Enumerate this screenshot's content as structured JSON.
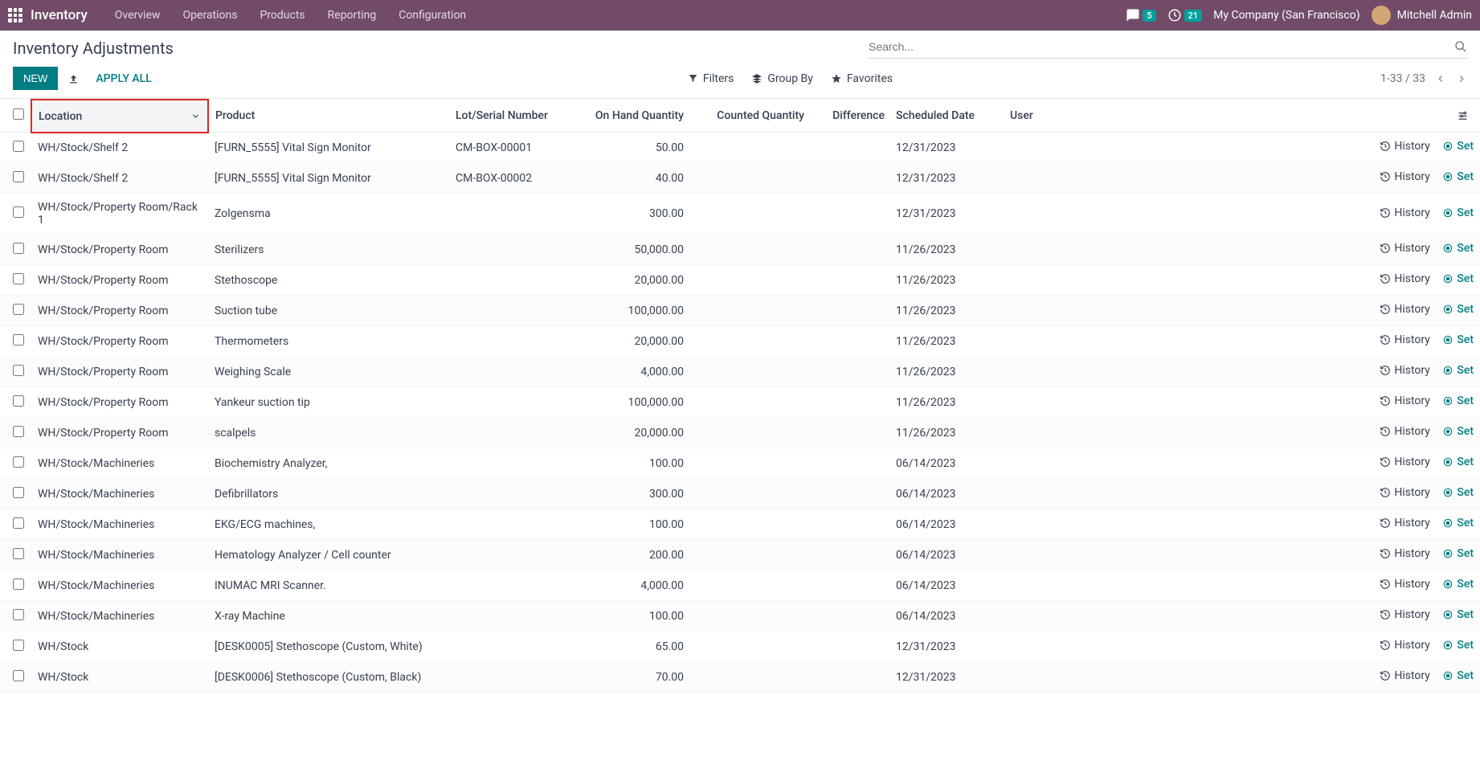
{
  "navbar": {
    "app_name": "Inventory",
    "menu": [
      "Overview",
      "Operations",
      "Products",
      "Reporting",
      "Configuration"
    ],
    "messages_badge": "5",
    "activities_badge": "21",
    "company": "My Company (San Francisco)",
    "user": "Mitchell Admin"
  },
  "page": {
    "title": "Inventory Adjustments",
    "search_placeholder": "Search...",
    "btn_new": "NEW",
    "btn_apply_all": "APPLY ALL",
    "filters_label": "Filters",
    "groupby_label": "Group By",
    "favorites_label": "Favorites",
    "pager": "1-33 / 33"
  },
  "columns": {
    "location": "Location",
    "product": "Product",
    "lot": "Lot/Serial Number",
    "on_hand": "On Hand Quantity",
    "counted": "Counted Quantity",
    "difference": "Difference",
    "scheduled": "Scheduled Date",
    "user": "User"
  },
  "actions": {
    "history": "History",
    "set": "Set"
  },
  "rows": [
    {
      "location": "WH/Stock/Shelf 2",
      "product": "[FURN_5555] Vital Sign Monitor",
      "lot": "CM-BOX-00001",
      "on_hand": "50.00",
      "counted": "",
      "difference": "",
      "scheduled": "12/31/2023",
      "user": ""
    },
    {
      "location": "WH/Stock/Shelf 2",
      "product": "[FURN_5555] Vital Sign Monitor",
      "lot": "CM-BOX-00002",
      "on_hand": "40.00",
      "counted": "",
      "difference": "",
      "scheduled": "12/31/2023",
      "user": ""
    },
    {
      "location": "WH/Stock/Property Room/Rack 1",
      "product": "Zolgensma",
      "lot": "",
      "on_hand": "300.00",
      "counted": "",
      "difference": "",
      "scheduled": "12/31/2023",
      "user": ""
    },
    {
      "location": "WH/Stock/Property Room",
      "product": "Sterilizers",
      "lot": "",
      "on_hand": "50,000.00",
      "counted": "",
      "difference": "",
      "scheduled": "11/26/2023",
      "user": ""
    },
    {
      "location": "WH/Stock/Property Room",
      "product": "Stethoscope",
      "lot": "",
      "on_hand": "20,000.00",
      "counted": "",
      "difference": "",
      "scheduled": "11/26/2023",
      "user": ""
    },
    {
      "location": "WH/Stock/Property Room",
      "product": "Suction tube",
      "lot": "",
      "on_hand": "100,000.00",
      "counted": "",
      "difference": "",
      "scheduled": "11/26/2023",
      "user": ""
    },
    {
      "location": "WH/Stock/Property Room",
      "product": "Thermometers",
      "lot": "",
      "on_hand": "20,000.00",
      "counted": "",
      "difference": "",
      "scheduled": "11/26/2023",
      "user": ""
    },
    {
      "location": "WH/Stock/Property Room",
      "product": "Weighing Scale",
      "lot": "",
      "on_hand": "4,000.00",
      "counted": "",
      "difference": "",
      "scheduled": "11/26/2023",
      "user": ""
    },
    {
      "location": "WH/Stock/Property Room",
      "product": "Yankeur suction tip",
      "lot": "",
      "on_hand": "100,000.00",
      "counted": "",
      "difference": "",
      "scheduled": "11/26/2023",
      "user": ""
    },
    {
      "location": "WH/Stock/Property Room",
      "product": "scalpels",
      "lot": "",
      "on_hand": "20,000.00",
      "counted": "",
      "difference": "",
      "scheduled": "11/26/2023",
      "user": ""
    },
    {
      "location": "WH/Stock/Machineries",
      "product": "Biochemistry Analyzer,",
      "lot": "",
      "on_hand": "100.00",
      "counted": "",
      "difference": "",
      "scheduled": "06/14/2023",
      "user": ""
    },
    {
      "location": "WH/Stock/Machineries",
      "product": "Defibrillators",
      "lot": "",
      "on_hand": "300.00",
      "counted": "",
      "difference": "",
      "scheduled": "06/14/2023",
      "user": ""
    },
    {
      "location": "WH/Stock/Machineries",
      "product": "EKG/ECG machines,",
      "lot": "",
      "on_hand": "100.00",
      "counted": "",
      "difference": "",
      "scheduled": "06/14/2023",
      "user": ""
    },
    {
      "location": "WH/Stock/Machineries",
      "product": "Hematology Analyzer / Cell counter",
      "lot": "",
      "on_hand": "200.00",
      "counted": "",
      "difference": "",
      "scheduled": "06/14/2023",
      "user": ""
    },
    {
      "location": "WH/Stock/Machineries",
      "product": "INUMAC MRI Scanner.",
      "lot": "",
      "on_hand": "4,000.00",
      "counted": "",
      "difference": "",
      "scheduled": "06/14/2023",
      "user": ""
    },
    {
      "location": "WH/Stock/Machineries",
      "product": "X-ray Machine",
      "lot": "",
      "on_hand": "100.00",
      "counted": "",
      "difference": "",
      "scheduled": "06/14/2023",
      "user": ""
    },
    {
      "location": "WH/Stock",
      "product": "[DESK0005] Stethoscope (Custom, White)",
      "lot": "",
      "on_hand": "65.00",
      "counted": "",
      "difference": "",
      "scheduled": "12/31/2023",
      "user": ""
    },
    {
      "location": "WH/Stock",
      "product": "[DESK0006] Stethoscope (Custom, Black)",
      "lot": "",
      "on_hand": "70.00",
      "counted": "",
      "difference": "",
      "scheduled": "12/31/2023",
      "user": ""
    }
  ]
}
